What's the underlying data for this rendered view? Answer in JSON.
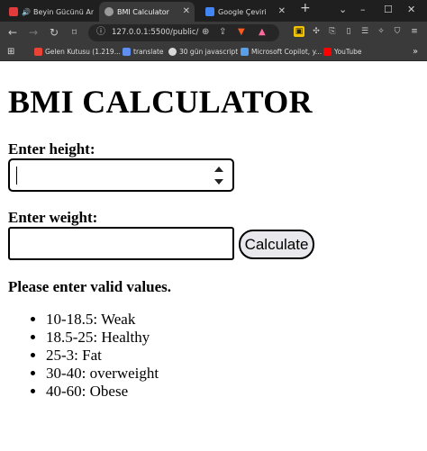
{
  "browser": {
    "tabs": [
      {
        "title": "Beyin Gücünü Artırı",
        "favicon_color": "#e23b3b"
      },
      {
        "title": "BMI Calculator",
        "favicon_color": "#9a9a9a"
      },
      {
        "title": "Google Çeviri",
        "favicon_color": "#4285f4"
      }
    ],
    "new_tab_symbol": "+",
    "url": "127.0.0.1:5500/public/",
    "bookmarks": [
      {
        "label": "Gelen Kutusu (1.219...",
        "color": "#ea4335"
      },
      {
        "label": "translate",
        "color": "#5f8ff0"
      },
      {
        "label": "30 gün javascript",
        "color": "#d9d9d9"
      },
      {
        "label": "Microsoft Copilot, y...",
        "color": "#5aa0e8"
      },
      {
        "label": "YouTube",
        "color": "#ff0000"
      }
    ]
  },
  "page": {
    "title": "BMI CALCULATOR",
    "height_label": "Enter height:",
    "weight_label": "Enter weight:",
    "height_value": "",
    "weight_value": "",
    "calculate_label": "Calculate",
    "message": "Please enter valid values.",
    "ranges": [
      "10-18.5: Weak",
      "18.5-25: Healthy",
      "25-3: Fat",
      "30-40: overweight",
      "40-60: Obese"
    ]
  }
}
